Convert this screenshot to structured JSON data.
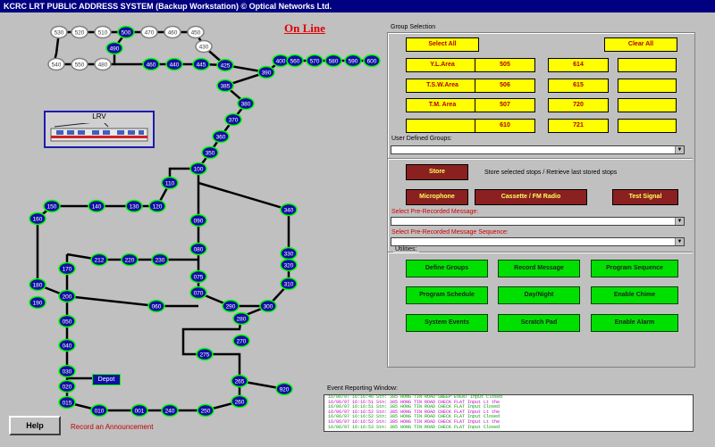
{
  "window": {
    "title": "KCRC LRT PUBLIC ADDRESS SYSTEM  (Backup Workstation)   © Optical Networks Ltd."
  },
  "status": {
    "online": "On Line"
  },
  "map": {
    "lrv_label": "LRV",
    "depot_label": "Depot",
    "colors": {
      "stop_fill": "#1010a0",
      "stop_ring": "#00ff00",
      "white_stop": "#ffffff",
      "track": "#000000"
    },
    "stops": [
      {
        "id": "530",
        "style": "white"
      },
      {
        "id": "520",
        "style": "white"
      },
      {
        "id": "510",
        "style": "white"
      },
      {
        "id": "500",
        "style": "blue"
      },
      {
        "id": "470",
        "style": "white"
      },
      {
        "id": "460",
        "style": "white"
      },
      {
        "id": "450",
        "style": "white"
      },
      {
        "id": "430",
        "style": "white"
      },
      {
        "id": "490",
        "style": "blue"
      },
      {
        "id": "540",
        "style": "white"
      },
      {
        "id": "550",
        "style": "white"
      },
      {
        "id": "480",
        "style": "white"
      },
      {
        "id": "460",
        "style": "blue"
      },
      {
        "id": "440",
        "style": "blue"
      },
      {
        "id": "445",
        "style": "blue"
      },
      {
        "id": "425",
        "style": "blue"
      },
      {
        "id": "400",
        "style": "blue"
      },
      {
        "id": "560",
        "style": "blue"
      },
      {
        "id": "570",
        "style": "blue"
      },
      {
        "id": "580",
        "style": "blue"
      },
      {
        "id": "590",
        "style": "blue"
      },
      {
        "id": "600",
        "style": "blue"
      },
      {
        "id": "390",
        "style": "blue"
      },
      {
        "id": "385",
        "style": "blue"
      },
      {
        "id": "380",
        "style": "blue"
      },
      {
        "id": "370",
        "style": "blue"
      },
      {
        "id": "360",
        "style": "blue"
      },
      {
        "id": "350",
        "style": "blue"
      },
      {
        "id": "100",
        "style": "blue"
      },
      {
        "id": "110",
        "style": "blue"
      },
      {
        "id": "120",
        "style": "blue"
      },
      {
        "id": "130",
        "style": "blue"
      },
      {
        "id": "140",
        "style": "blue"
      },
      {
        "id": "150",
        "style": "blue"
      },
      {
        "id": "160",
        "style": "blue"
      },
      {
        "id": "340",
        "style": "blue"
      },
      {
        "id": "330",
        "style": "blue"
      },
      {
        "id": "320",
        "style": "blue"
      },
      {
        "id": "310",
        "style": "blue"
      },
      {
        "id": "300",
        "style": "blue"
      },
      {
        "id": "090",
        "style": "blue"
      },
      {
        "id": "080",
        "style": "blue"
      },
      {
        "id": "075",
        "style": "blue"
      },
      {
        "id": "070",
        "style": "blue"
      },
      {
        "id": "212",
        "style": "blue"
      },
      {
        "id": "220",
        "style": "blue"
      },
      {
        "id": "230",
        "style": "blue"
      },
      {
        "id": "170",
        "style": "blue"
      },
      {
        "id": "180",
        "style": "blue"
      },
      {
        "id": "190",
        "style": "blue"
      },
      {
        "id": "200",
        "style": "blue"
      },
      {
        "id": "060",
        "style": "blue"
      },
      {
        "id": "290",
        "style": "blue"
      },
      {
        "id": "280",
        "style": "blue"
      },
      {
        "id": "270",
        "style": "blue"
      },
      {
        "id": "275",
        "style": "blue"
      },
      {
        "id": "265",
        "style": "blue"
      },
      {
        "id": "260",
        "style": "blue"
      },
      {
        "id": "920",
        "style": "blue"
      },
      {
        "id": "050",
        "style": "blue"
      },
      {
        "id": "040",
        "style": "blue"
      },
      {
        "id": "030",
        "style": "blue"
      },
      {
        "id": "020",
        "style": "blue"
      },
      {
        "id": "015",
        "style": "blue"
      },
      {
        "id": "010",
        "style": "blue"
      },
      {
        "id": "001",
        "style": "blue"
      },
      {
        "id": "240",
        "style": "blue"
      },
      {
        "id": "250",
        "style": "blue"
      }
    ]
  },
  "group_selection": {
    "title": "Group Selection",
    "select_all": "Select All",
    "clear_all": "Clear All",
    "rows": [
      [
        "Y.L.Area",
        "505",
        "614",
        ""
      ],
      [
        "T.S.W.Area",
        "506",
        "615",
        ""
      ],
      [
        "T.M. Area",
        "507",
        "720",
        ""
      ],
      [
        "",
        "610",
        "721",
        ""
      ]
    ],
    "user_defined_label": "User Defined Groups:",
    "user_defined_value": ""
  },
  "store": {
    "button": "Store",
    "hint": "Store selected stops / Retrieve last stored stops"
  },
  "audio": {
    "microphone": "Microphone",
    "cassette": "Cassette / FM Radio",
    "test_signal": "Test Signal"
  },
  "messages": {
    "prerecorded_label": "Select Pre-Recorded Message:",
    "prerecorded_value": "",
    "sequence_label": "Select Pre-Recorded Message Sequence:",
    "sequence_value": ""
  },
  "utilities": {
    "title": "Utilities:",
    "buttons": [
      "Define Groups",
      "Record Message",
      "Program Sequence",
      "Program Schedule",
      "Day/Night",
      "Enable Chime",
      "System Events",
      "Scratch Pad",
      "Enable Alarm"
    ]
  },
  "events": {
    "title": "Event Reporting Window:",
    "lines": [
      {
        "text": "16/06/97 16:16:46 Stn: 385 HONG TIN ROAD SWEEP EVENT Input Closed",
        "color": "#00a000"
      },
      {
        "text": "16/06/97 16:16:51 Stn: 385 HONG TIN ROAD CHECK FLAT Input Lt the",
        "color": "#c000c0"
      },
      {
        "text": "16/06/97 16:16:51 Stn: 385 HONG TIN ROAD CHECK FLAT Input Closed",
        "color": "#00a000"
      },
      {
        "text": "16/06/97 16:16:52 Stn: 385 HONG TIN ROAD CHECK FLAT Input Lt the",
        "color": "#c000c0"
      },
      {
        "text": "16/06/97 16:16:52 Stn: 385 HONG TIN ROAD CHECK FLAT Input Closed",
        "color": "#00a000"
      },
      {
        "text": "16/06/97 16:16:52 Stn: 385 HONG TIN ROAD CHECK FLAT Input Lt the",
        "color": "#c000c0"
      },
      {
        "text": "16/06/97 16:16:53 Stn: 385 HONG TIN ROAD CHECK FLAT Input Closed",
        "color": "#00a000"
      }
    ]
  },
  "footer": {
    "help": "Help",
    "record_prompt": "Record an Announcement"
  }
}
